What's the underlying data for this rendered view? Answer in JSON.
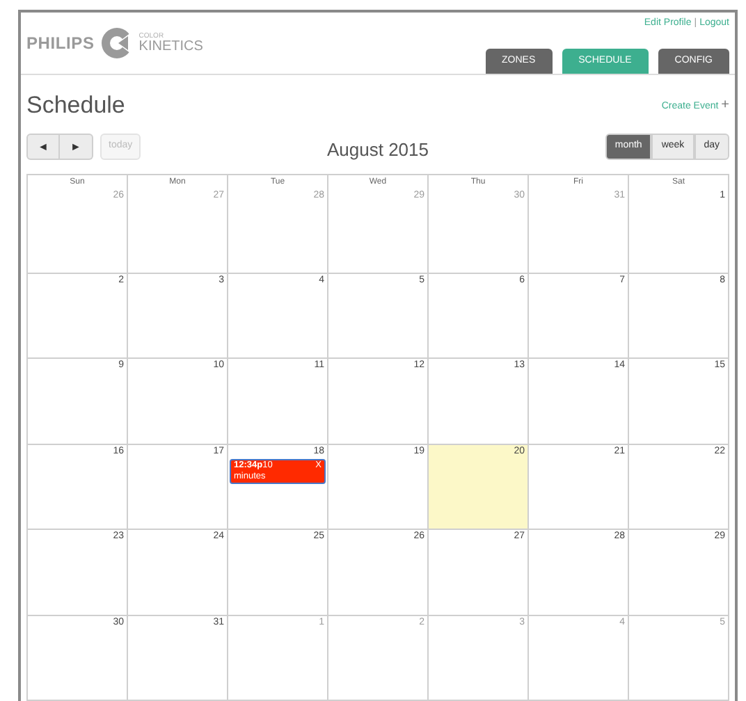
{
  "brand": {
    "name": "PHILIPS",
    "sub_top": "COLOR",
    "sub": "KINETICS"
  },
  "user_links": [
    "Edit Profile",
    "Logout"
  ],
  "link_separator": "|",
  "tabs": [
    {
      "label": "ZONES",
      "selected": false
    },
    {
      "label": "SCHEDULE",
      "selected": true
    },
    {
      "label": "CONFIG",
      "selected": false
    }
  ],
  "page_title": "Schedule",
  "create_event": {
    "label": "Create Event",
    "icon": "+"
  },
  "nav": {
    "prev": "◄",
    "next": "►",
    "today": {
      "label": "today",
      "disabled": true
    }
  },
  "month_title": "August 2015",
  "views": [
    {
      "label": "month",
      "selected": true
    },
    {
      "label": "week",
      "selected": false
    },
    {
      "label": "day",
      "selected": false
    }
  ],
  "weekdays": [
    "Sun",
    "Mon",
    "Tue",
    "Wed",
    "Thu",
    "Fri",
    "Sat"
  ],
  "weeks": [
    [
      {
        "num": "26",
        "other_month": true,
        "today": false
      },
      {
        "num": "27",
        "other_month": true,
        "today": false
      },
      {
        "num": "28",
        "other_month": true,
        "today": false
      },
      {
        "num": "29",
        "other_month": true,
        "today": false
      },
      {
        "num": "30",
        "other_month": true,
        "today": false
      },
      {
        "num": "31",
        "other_month": true,
        "today": false
      },
      {
        "num": "1",
        "other_month": false,
        "today": false
      }
    ],
    [
      {
        "num": "2",
        "other_month": false,
        "today": false
      },
      {
        "num": "3",
        "other_month": false,
        "today": false
      },
      {
        "num": "4",
        "other_month": false,
        "today": false
      },
      {
        "num": "5",
        "other_month": false,
        "today": false
      },
      {
        "num": "6",
        "other_month": false,
        "today": false
      },
      {
        "num": "7",
        "other_month": false,
        "today": false
      },
      {
        "num": "8",
        "other_month": false,
        "today": false
      }
    ],
    [
      {
        "num": "9",
        "other_month": false,
        "today": false
      },
      {
        "num": "10",
        "other_month": false,
        "today": false
      },
      {
        "num": "11",
        "other_month": false,
        "today": false
      },
      {
        "num": "12",
        "other_month": false,
        "today": false
      },
      {
        "num": "13",
        "other_month": false,
        "today": false
      },
      {
        "num": "14",
        "other_month": false,
        "today": false
      },
      {
        "num": "15",
        "other_month": false,
        "today": false
      }
    ],
    [
      {
        "num": "16",
        "other_month": false,
        "today": false
      },
      {
        "num": "17",
        "other_month": false,
        "today": false
      },
      {
        "num": "18",
        "other_month": false,
        "today": false,
        "events": [
          {
            "time": "12:34p",
            "title": "10 minutes",
            "close": "X",
            "color": "#ff2a00"
          }
        ]
      },
      {
        "num": "19",
        "other_month": false,
        "today": false
      },
      {
        "num": "20",
        "other_month": false,
        "today": true
      },
      {
        "num": "21",
        "other_month": false,
        "today": false
      },
      {
        "num": "22",
        "other_month": false,
        "today": false
      }
    ],
    [
      {
        "num": "23",
        "other_month": false,
        "today": false
      },
      {
        "num": "24",
        "other_month": false,
        "today": false
      },
      {
        "num": "25",
        "other_month": false,
        "today": false
      },
      {
        "num": "26",
        "other_month": false,
        "today": false
      },
      {
        "num": "27",
        "other_month": false,
        "today": false
      },
      {
        "num": "28",
        "other_month": false,
        "today": false
      },
      {
        "num": "29",
        "other_month": false,
        "today": false
      }
    ],
    [
      {
        "num": "30",
        "other_month": false,
        "today": false
      },
      {
        "num": "31",
        "other_month": false,
        "today": false
      },
      {
        "num": "1",
        "other_month": true,
        "today": false
      },
      {
        "num": "2",
        "other_month": true,
        "today": false
      },
      {
        "num": "3",
        "other_month": true,
        "today": false
      },
      {
        "num": "4",
        "other_month": true,
        "today": false
      },
      {
        "num": "5",
        "other_month": true,
        "today": false
      }
    ]
  ]
}
